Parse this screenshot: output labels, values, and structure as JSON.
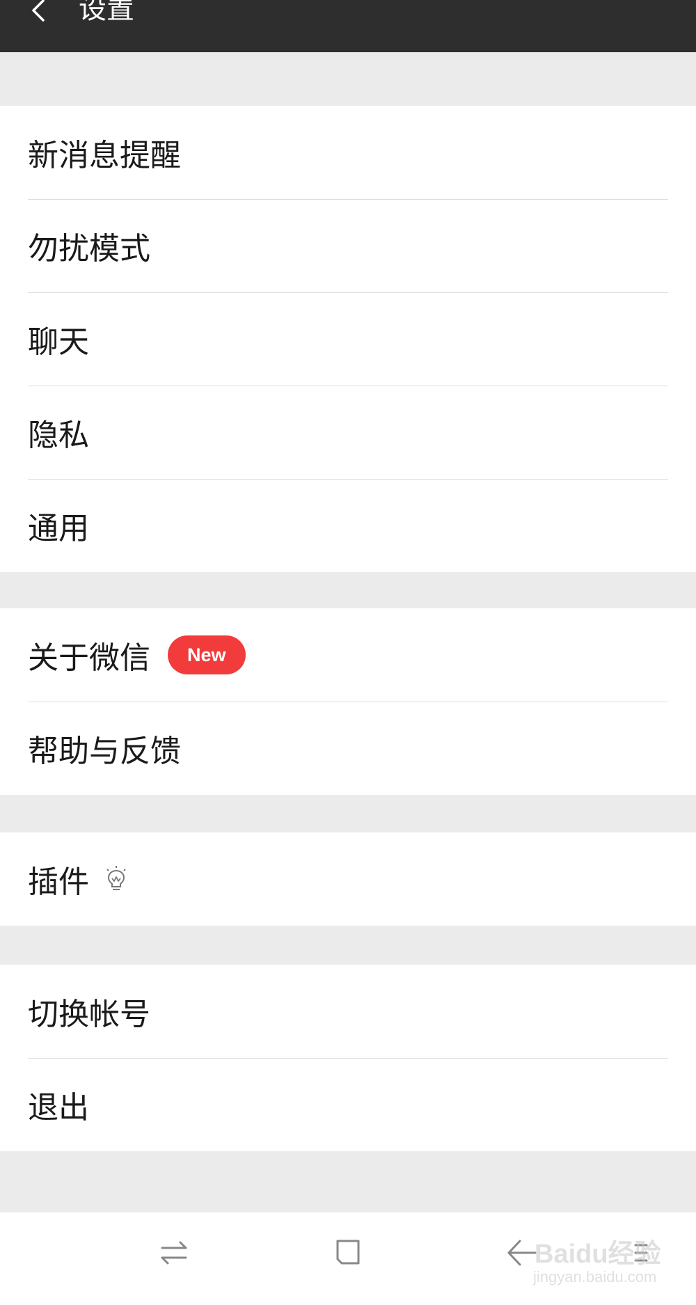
{
  "header": {
    "title": "设置",
    "back_icon": "chevron-left-icon"
  },
  "groups": [
    {
      "items": [
        {
          "label": "新消息提醒"
        },
        {
          "label": "勿扰模式"
        },
        {
          "label": "聊天"
        },
        {
          "label": "隐私"
        },
        {
          "label": "通用"
        }
      ]
    },
    {
      "items": [
        {
          "label": "关于微信",
          "badge": "New"
        },
        {
          "label": "帮助与反馈"
        }
      ]
    },
    {
      "items": [
        {
          "label": "插件",
          "icon": "lightbulb-icon"
        }
      ]
    },
    {
      "items": [
        {
          "label": "切换帐号"
        },
        {
          "label": "退出"
        }
      ]
    }
  ],
  "navbar": {
    "icons": [
      "recent-apps-swap-icon",
      "home-square-icon",
      "back-arrow-icon",
      "menu-icon"
    ]
  },
  "watermark": {
    "brand": "Baidu经验",
    "url": "jingyan.baidu.com"
  },
  "colors": {
    "header_bg": "#2e2e2e",
    "page_bg": "#ebebeb",
    "badge_red": "#f23c3c",
    "divider": "#dcdcdc"
  }
}
